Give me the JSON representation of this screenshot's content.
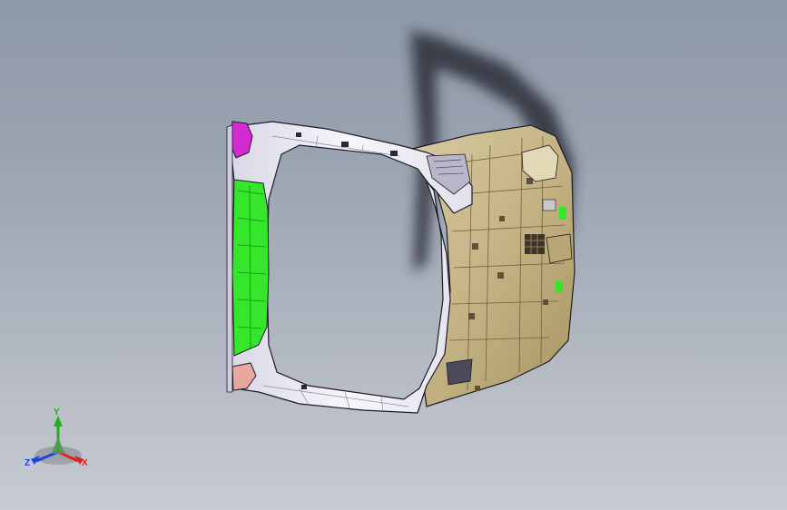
{
  "viewport": {
    "background_top": "#8e99a8",
    "background_bottom": "#c7cbd2"
  },
  "model": {
    "colors": {
      "frame_white": "#f2f1f7",
      "frame_shade": "#cfcde0",
      "panel_tan": "#c9b98e",
      "panel_tan_dark": "#8f7f55",
      "side_green": "#35e62a",
      "top_magenta": "#d42ad4",
      "bottom_salmon": "#e8a8a0",
      "edge_dark": "#1c1c24",
      "shadow": "#2a2f38"
    }
  },
  "triad": {
    "x_label": "X",
    "y_label": "Y",
    "z_label": "Z",
    "x_color": "#e02020",
    "y_color": "#20b020",
    "z_color": "#2040e0"
  }
}
